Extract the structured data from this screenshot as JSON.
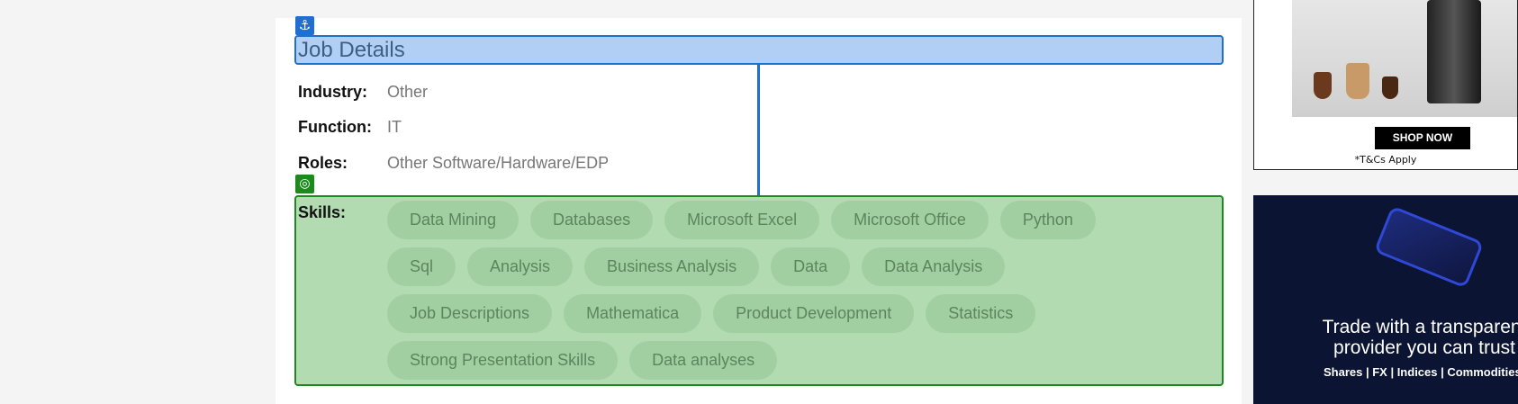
{
  "job": {
    "title": "Job Details",
    "anchor_icon": "⚓",
    "target_icon": "◎",
    "rows": [
      {
        "label": "Industry:",
        "value": "Other"
      },
      {
        "label": "Function:",
        "value": "IT"
      },
      {
        "label": "Roles:",
        "value": "Other Software/Hardware/EDP"
      }
    ],
    "skills_label": "Skills:",
    "skills": [
      [
        "Data Mining",
        "Databases",
        "Microsoft Excel",
        "Microsoft Office",
        "Python"
      ],
      [
        "Sql",
        "Analysis",
        "Business Analysis",
        "Data",
        "Data Analysis"
      ],
      [
        "Job Descriptions",
        "Mathematica",
        "Product Development",
        "Statistics"
      ],
      [
        "Strong Presentation Skills",
        "Data analyses"
      ]
    ]
  },
  "ads": {
    "ad1": {
      "button": "SHOP NOW",
      "note": "*T&Cs Apply"
    },
    "ad2": {
      "headline_1": "Trade with a transparent",
      "headline_2": "provider you can trust",
      "sub": "Shares | FX | Indices | Commodities"
    }
  },
  "colors": {
    "title_bg": "#b1cff4",
    "title_border": "#1f6fd1",
    "skills_bg": "#b2dbb2",
    "skills_border": "#1d8a1d"
  }
}
